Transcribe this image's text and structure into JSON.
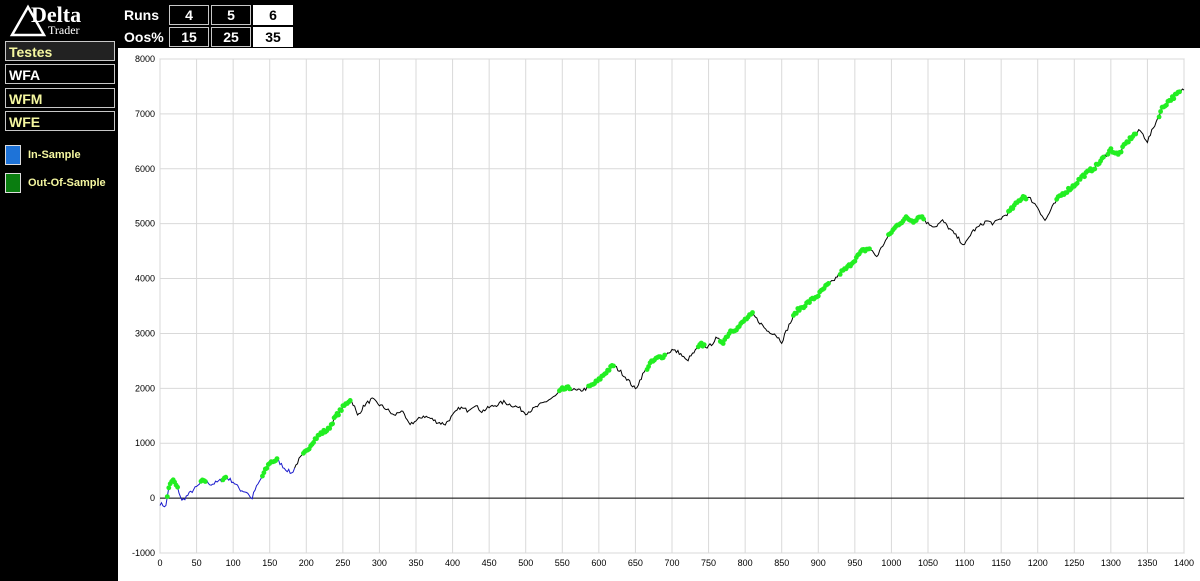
{
  "logo": {
    "line1": "Delta",
    "line2": "Trader"
  },
  "params": {
    "runs_label": "Runs",
    "oos_label": "Oos%",
    "runs": [
      {
        "value": "4",
        "active": false
      },
      {
        "value": "5",
        "active": false
      },
      {
        "value": "6",
        "active": true
      }
    ],
    "oos": [
      {
        "value": "15",
        "active": false
      },
      {
        "value": "25",
        "active": false
      },
      {
        "value": "35",
        "active": true
      }
    ]
  },
  "sidebar": {
    "items": [
      {
        "label": "Testes",
        "selected": true
      },
      {
        "label": "WFA",
        "selected": false
      },
      {
        "label": "WFM",
        "selected": false
      },
      {
        "label": "WFE",
        "selected": false
      }
    ]
  },
  "legend": [
    {
      "label": "In-Sample",
      "color": "#1e73d8"
    },
    {
      "label": "Out-Of-Sample",
      "color": "#0a7d10"
    }
  ],
  "colors": {
    "insample_line": "#1a1acc",
    "equity_line": "#000000",
    "oos_marker": "#22ee22"
  },
  "chart_data": {
    "type": "line",
    "xlim": [
      0,
      1400
    ],
    "ylim": [
      -1000,
      8000
    ],
    "x_ticks": [
      0,
      50,
      100,
      150,
      200,
      250,
      300,
      350,
      400,
      450,
      500,
      550,
      600,
      650,
      700,
      750,
      800,
      850,
      900,
      950,
      1000,
      1050,
      1100,
      1150,
      1200,
      1250,
      1300,
      1350,
      1400
    ],
    "y_ticks": [
      -1000,
      0,
      1000,
      2000,
      3000,
      4000,
      5000,
      6000,
      7000,
      8000
    ],
    "grid": true,
    "insample_end": 185,
    "equity_curve": [
      [
        0,
        -100
      ],
      [
        8,
        -150
      ],
      [
        12,
        200
      ],
      [
        18,
        330
      ],
      [
        25,
        150
      ],
      [
        30,
        -50
      ],
      [
        40,
        80
      ],
      [
        50,
        200
      ],
      [
        60,
        330
      ],
      [
        70,
        250
      ],
      [
        80,
        300
      ],
      [
        90,
        380
      ],
      [
        100,
        300
      ],
      [
        110,
        150
      ],
      [
        120,
        100
      ],
      [
        125,
        -30
      ],
      [
        130,
        150
      ],
      [
        140,
        400
      ],
      [
        150,
        650
      ],
      [
        160,
        700
      ],
      [
        170,
        550
      ],
      [
        180,
        450
      ],
      [
        190,
        700
      ],
      [
        200,
        850
      ],
      [
        210,
        1050
      ],
      [
        220,
        1180
      ],
      [
        230,
        1250
      ],
      [
        240,
        1480
      ],
      [
        250,
        1650
      ],
      [
        260,
        1800
      ],
      [
        265,
        1700
      ],
      [
        270,
        1500
      ],
      [
        280,
        1700
      ],
      [
        290,
        1800
      ],
      [
        300,
        1700
      ],
      [
        310,
        1620
      ],
      [
        320,
        1500
      ],
      [
        330,
        1600
      ],
      [
        340,
        1350
      ],
      [
        350,
        1400
      ],
      [
        360,
        1500
      ],
      [
        370,
        1450
      ],
      [
        380,
        1380
      ],
      [
        390,
        1350
      ],
      [
        400,
        1500
      ],
      [
        410,
        1650
      ],
      [
        420,
        1600
      ],
      [
        430,
        1700
      ],
      [
        440,
        1580
      ],
      [
        450,
        1650
      ],
      [
        460,
        1700
      ],
      [
        470,
        1750
      ],
      [
        480,
        1700
      ],
      [
        490,
        1650
      ],
      [
        500,
        1550
      ],
      [
        510,
        1620
      ],
      [
        520,
        1700
      ],
      [
        530,
        1780
      ],
      [
        540,
        1850
      ],
      [
        550,
        1980
      ],
      [
        560,
        2000
      ],
      [
        570,
        1950
      ],
      [
        580,
        1980
      ],
      [
        590,
        2050
      ],
      [
        600,
        2150
      ],
      [
        610,
        2300
      ],
      [
        620,
        2420
      ],
      [
        630,
        2300
      ],
      [
        640,
        2150
      ],
      [
        650,
        1980
      ],
      [
        660,
        2250
      ],
      [
        670,
        2450
      ],
      [
        680,
        2550
      ],
      [
        690,
        2600
      ],
      [
        700,
        2700
      ],
      [
        710,
        2650
      ],
      [
        720,
        2500
      ],
      [
        730,
        2650
      ],
      [
        740,
        2800
      ],
      [
        750,
        2750
      ],
      [
        760,
        2900
      ],
      [
        770,
        2850
      ],
      [
        780,
        3050
      ],
      [
        790,
        3100
      ],
      [
        800,
        3250
      ],
      [
        810,
        3350
      ],
      [
        820,
        3200
      ],
      [
        830,
        3050
      ],
      [
        840,
        3000
      ],
      [
        850,
        2850
      ],
      [
        860,
        3150
      ],
      [
        870,
        3400
      ],
      [
        880,
        3500
      ],
      [
        890,
        3600
      ],
      [
        900,
        3700
      ],
      [
        910,
        3850
      ],
      [
        920,
        3950
      ],
      [
        930,
        4100
      ],
      [
        940,
        4200
      ],
      [
        950,
        4350
      ],
      [
        960,
        4500
      ],
      [
        970,
        4550
      ],
      [
        980,
        4400
      ],
      [
        990,
        4650
      ],
      [
        1000,
        4850
      ],
      [
        1010,
        5000
      ],
      [
        1020,
        5100
      ],
      [
        1030,
        5050
      ],
      [
        1040,
        5150
      ],
      [
        1050,
        5000
      ],
      [
        1060,
        4950
      ],
      [
        1070,
        5050
      ],
      [
        1080,
        4900
      ],
      [
        1090,
        4750
      ],
      [
        1100,
        4600
      ],
      [
        1110,
        4850
      ],
      [
        1120,
        4950
      ],
      [
        1130,
        5050
      ],
      [
        1140,
        5000
      ],
      [
        1150,
        5100
      ],
      [
        1160,
        5200
      ],
      [
        1170,
        5350
      ],
      [
        1180,
        5500
      ],
      [
        1190,
        5450
      ],
      [
        1200,
        5300
      ],
      [
        1210,
        5050
      ],
      [
        1220,
        5300
      ],
      [
        1230,
        5500
      ],
      [
        1240,
        5600
      ],
      [
        1250,
        5700
      ],
      [
        1260,
        5850
      ],
      [
        1270,
        5950
      ],
      [
        1280,
        6050
      ],
      [
        1290,
        6200
      ],
      [
        1300,
        6350
      ],
      [
        1310,
        6250
      ],
      [
        1320,
        6450
      ],
      [
        1330,
        6600
      ],
      [
        1340,
        6700
      ],
      [
        1350,
        6500
      ],
      [
        1360,
        6800
      ],
      [
        1370,
        7100
      ],
      [
        1380,
        7250
      ],
      [
        1390,
        7350
      ],
      [
        1400,
        7450
      ]
    ],
    "oos_segments": [
      [
        10,
        25
      ],
      [
        55,
        62
      ],
      [
        85,
        90
      ],
      [
        140,
        160
      ],
      [
        195,
        260
      ],
      [
        545,
        560
      ],
      [
        585,
        620
      ],
      [
        665,
        690
      ],
      [
        735,
        745
      ],
      [
        765,
        810
      ],
      [
        865,
        915
      ],
      [
        930,
        970
      ],
      [
        995,
        1045
      ],
      [
        1160,
        1185
      ],
      [
        1225,
        1290
      ],
      [
        1295,
        1335
      ],
      [
        1365,
        1395
      ]
    ]
  }
}
